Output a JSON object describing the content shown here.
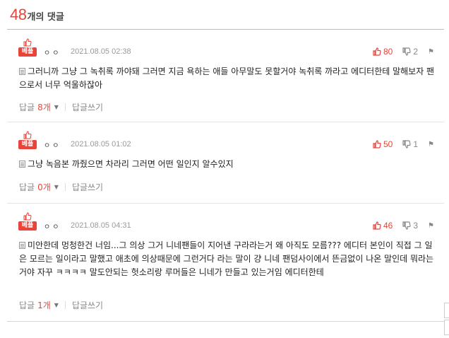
{
  "header": {
    "count": "48",
    "label": "개의 댓글"
  },
  "comments": [
    {
      "badge": "베플",
      "nickname": "ㅇㅇ",
      "date": "2021.08.05 02:38",
      "likes": "80",
      "dislikes": "2",
      "text": "그러니까 그냥 그 녹취록 까야돼 그러면 지금 욕하는 애들 아무말도 못할거야 녹취록 까라고 에디터한테 말해보자 팬으로서 너무 억울하잖아",
      "reply_label": "답글",
      "reply_count": "8개",
      "write_label": "답글쓰기"
    },
    {
      "badge": "베플",
      "nickname": "ㅇㅇ",
      "date": "2021.08.05 01:02",
      "likes": "50",
      "dislikes": "1",
      "text": "그냥 녹음본 까줬으면 차라리 그러면 어떤 일인지 알수있지",
      "reply_label": "답글",
      "reply_count": "0개",
      "write_label": "답글쓰기"
    },
    {
      "badge": "베플",
      "nickname": "ㅇㅇ",
      "date": "2021.08.05 04:31",
      "likes": "46",
      "dislikes": "3",
      "text": "미안한데 멍청한건 너임...그 의상 그거 니네팬들이 지어낸 구라라는거 왜 아직도 모름??? 에디터 본인이 직접 그 일은 모르는 일이라고 말했고 애초에 의상때문에 그런거다 라는 말이 걍 니네 팬덤사이에서 뜬금없이 나온 말인데 뭐라는거야 자꾸 ㅋㅋㅋㅋ 말도안되는 헛소리랑 루머들은 니네가 만들고 있는거임 에디터한테",
      "reply_label": "답글",
      "reply_count": "1개",
      "write_label": "답글쓰기"
    }
  ],
  "colors": {
    "accent": "#e8443a",
    "muted": "#9a9a9a",
    "divider": "#e4e4e4"
  },
  "icons": {
    "best": "thumbs-up-icon",
    "like": "thumbs-up-icon",
    "dislike": "thumbs-down-icon",
    "report": "flag-icon",
    "post": "document-icon",
    "expand": "caret-down-icon"
  }
}
